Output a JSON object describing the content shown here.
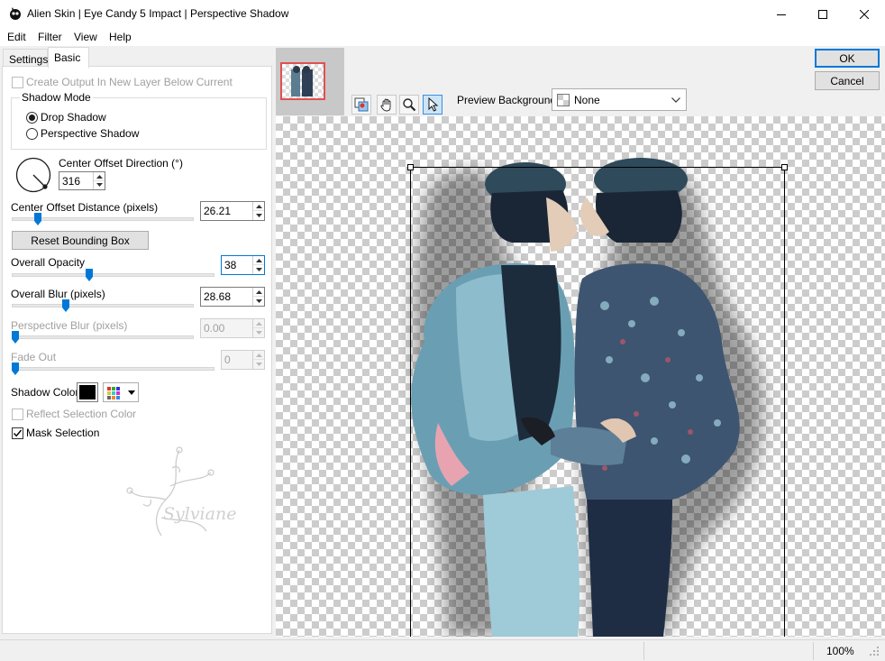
{
  "window": {
    "title": "Alien Skin | Eye Candy 5 Impact | Perspective Shadow"
  },
  "menu": [
    "Edit",
    "Filter",
    "View",
    "Help"
  ],
  "tabs": {
    "settings": "Settings",
    "basic": "Basic"
  },
  "basic": {
    "create_output_label": "Create Output In New Layer Below Current",
    "create_output_checked": false,
    "shadow_mode_title": "Shadow Mode",
    "shadow_mode_options": [
      "Drop Shadow",
      "Perspective Shadow"
    ],
    "shadow_mode_selected": "Drop Shadow",
    "center_offset_direction_label": "Center Offset Direction (°)",
    "center_offset_direction_value": "316",
    "center_offset_distance_label": "Center Offset Distance (pixels)",
    "center_offset_distance_value": "26.21",
    "reset_bounding_box_label": "Reset Bounding Box",
    "overall_opacity_label": "Overall Opacity",
    "overall_opacity_value": "38",
    "overall_blur_label": "Overall Blur (pixels)",
    "overall_blur_value": "28.68",
    "perspective_blur_label": "Perspective Blur (pixels)",
    "perspective_blur_value": "0.00",
    "fade_out_label": "Fade Out",
    "fade_out_value": "0",
    "shadow_color_label": "Shadow Color",
    "shadow_color": "#000000",
    "reflect_selection_color_label": "Reflect Selection Color",
    "reflect_selection_color_checked": false,
    "mask_selection_label": "Mask Selection",
    "mask_selection_checked": true
  },
  "sliders": {
    "center_offset_distance": 0.13,
    "overall_opacity": 0.38,
    "overall_blur": 0.29,
    "perspective_blur": 0.0,
    "fade_out": 0.0
  },
  "watermark_text": "Sylviane",
  "toolbar": {
    "preview_background_label": "Preview Background:",
    "preview_background_value": "None"
  },
  "buttons": {
    "ok": "OK",
    "cancel": "Cancel"
  },
  "status": {
    "zoom": "100%"
  },
  "colors": {
    "accent": "#0078d7",
    "thumb_border": "#e05050"
  }
}
